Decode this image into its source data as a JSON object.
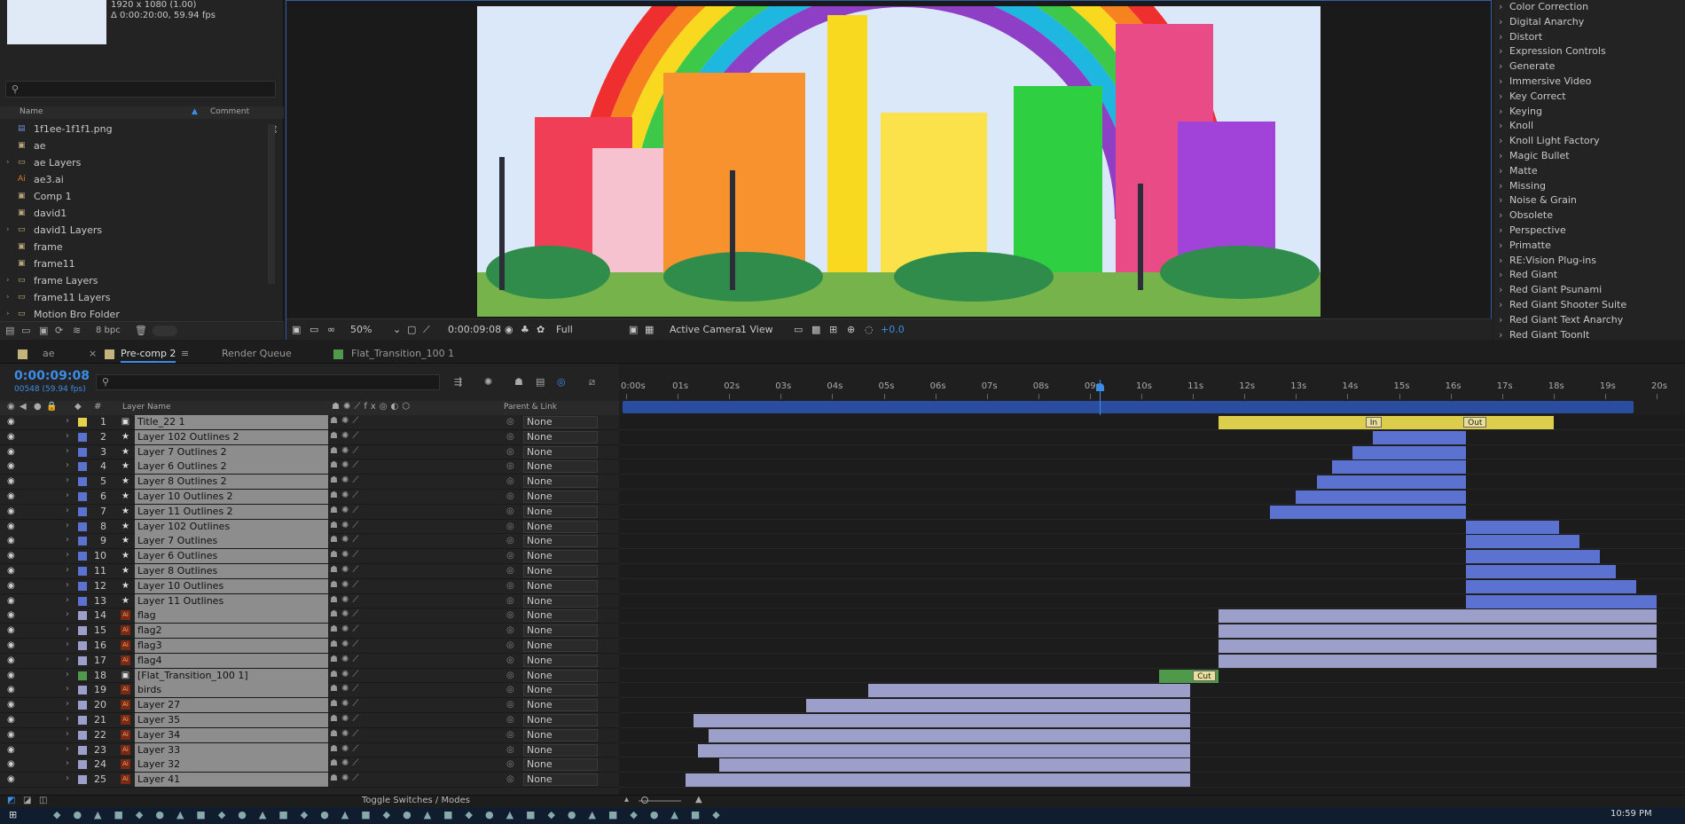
{
  "project": {
    "footage_info_line1": "1920 x 1080 (1.00)",
    "footage_info_line2": "Δ 0:00:20:00, 59.94 fps",
    "search_placeholder": "",
    "col_name": "Name",
    "col_comment": "Comment",
    "items": [
      {
        "name": "1f1ee-1f1f1.png",
        "icon": "image-file-icon",
        "folder": false
      },
      {
        "name": "ae",
        "icon": "composition-icon",
        "folder": false
      },
      {
        "name": "ae Layers",
        "icon": "folder-icon",
        "folder": true
      },
      {
        "name": "ae3.ai",
        "icon": "illustrator-file-icon",
        "folder": false
      },
      {
        "name": "Comp 1",
        "icon": "composition-icon",
        "folder": false
      },
      {
        "name": "david1",
        "icon": "composition-icon",
        "folder": false
      },
      {
        "name": "david1 Layers",
        "icon": "folder-icon",
        "folder": true
      },
      {
        "name": "frame",
        "icon": "composition-icon",
        "folder": false
      },
      {
        "name": "frame11",
        "icon": "composition-icon",
        "folder": false
      },
      {
        "name": "frame Layers",
        "icon": "folder-icon",
        "folder": true
      },
      {
        "name": "frame11 Layers",
        "icon": "folder-icon",
        "folder": true
      },
      {
        "name": "Motion Bro Folder",
        "icon": "folder-icon",
        "folder": true
      }
    ],
    "bpc": "8 bpc"
  },
  "viewer": {
    "zoom": "50%",
    "timecode": "0:00:09:08",
    "resolution": "Full",
    "camera": "Active Camera",
    "views": "1 View",
    "exposure": "+0.0"
  },
  "effects": [
    "Color Correction",
    "Digital Anarchy",
    "Distort",
    "Expression Controls",
    "Generate",
    "Immersive Video",
    "Key Correct",
    "Keying",
    "Knoll",
    "Knoll Light Factory",
    "Magic Bullet",
    "Matte",
    "Missing",
    "Noise & Grain",
    "Obsolete",
    "Perspective",
    "Primatte",
    "RE:Vision Plug-ins",
    "Red Giant",
    "Red Giant Psunami",
    "Red Giant Shooter Suite",
    "Red Giant Text Anarchy",
    "Red Giant ToonIt"
  ],
  "tabs": {
    "t1": "ae",
    "t2": "Pre-comp 2",
    "t3": "Render Queue",
    "t4": "Flat_Transition_100 1"
  },
  "timeline": {
    "current_time": "0:00:09:08",
    "frame_info": "00548 (59.94 fps)",
    "col_layer_name": "Layer Name",
    "col_parent": "Parent & Link",
    "ruler": [
      "0:00s",
      "01s",
      "02s",
      "03s",
      "04s",
      "05s",
      "06s",
      "07s",
      "08s",
      "09s",
      "10s",
      "11s",
      "12s",
      "13s",
      "14s",
      "15s",
      "16s",
      "17s",
      "18s",
      "19s",
      "20s"
    ],
    "marker_in": "In",
    "marker_out": "Out",
    "marker_cut": "Cut",
    "toggle_label": "Toggle Switches / Modes",
    "layers": [
      {
        "n": "1",
        "name": "Title_22 1",
        "type": "precomp",
        "color": "#e6d24a",
        "in": 11.5,
        "out": 18.0,
        "bar": "yel"
      },
      {
        "n": "2",
        "name": "Layer 102 Outlines 2",
        "type": "shape",
        "color": "#5b72d1",
        "in": 14.5,
        "out": 16.3,
        "bar": "blue"
      },
      {
        "n": "3",
        "name": "Layer 7 Outlines 2",
        "type": "shape",
        "color": "#5b72d1",
        "in": 14.1,
        "out": 16.3,
        "bar": "blue"
      },
      {
        "n": "4",
        "name": "Layer 6 Outlines 2",
        "type": "shape",
        "color": "#5b72d1",
        "in": 13.7,
        "out": 16.3,
        "bar": "blue"
      },
      {
        "n": "5",
        "name": "Layer 8 Outlines 2",
        "type": "shape",
        "color": "#5b72d1",
        "in": 13.4,
        "out": 16.3,
        "bar": "blue"
      },
      {
        "n": "6",
        "name": "Layer 10 Outlines 2",
        "type": "shape",
        "color": "#5b72d1",
        "in": 13.0,
        "out": 16.3,
        "bar": "blue"
      },
      {
        "n": "7",
        "name": "Layer 11 Outlines 2",
        "type": "shape",
        "color": "#5b72d1",
        "in": 12.5,
        "out": 16.3,
        "bar": "blue"
      },
      {
        "n": "8",
        "name": "Layer 102 Outlines",
        "type": "shape",
        "color": "#5b72d1",
        "in": 16.3,
        "out": 18.1,
        "bar": "blue"
      },
      {
        "n": "9",
        "name": "Layer 7 Outlines",
        "type": "shape",
        "color": "#5b72d1",
        "in": 16.3,
        "out": 18.5,
        "bar": "blue"
      },
      {
        "n": "10",
        "name": "Layer 6 Outlines",
        "type": "shape",
        "color": "#5b72d1",
        "in": 16.3,
        "out": 18.9,
        "bar": "blue"
      },
      {
        "n": "11",
        "name": "Layer 8 Outlines",
        "type": "shape",
        "color": "#5b72d1",
        "in": 16.3,
        "out": 19.2,
        "bar": "blue"
      },
      {
        "n": "12",
        "name": "Layer 10 Outlines",
        "type": "shape",
        "color": "#5b72d1",
        "in": 16.3,
        "out": 19.6,
        "bar": "blue"
      },
      {
        "n": "13",
        "name": "Layer 11 Outlines",
        "type": "shape",
        "color": "#5b72d1",
        "in": 16.3,
        "out": 20.0,
        "bar": "blue"
      },
      {
        "n": "14",
        "name": "flag",
        "type": "ai",
        "color": "#9d9fcb",
        "in": 11.5,
        "out": 20.0,
        "bar": "lav"
      },
      {
        "n": "15",
        "name": "flag2",
        "type": "ai",
        "color": "#9d9fcb",
        "in": 11.5,
        "out": 20.0,
        "bar": "lav"
      },
      {
        "n": "16",
        "name": "flag3",
        "type": "ai",
        "color": "#9d9fcb",
        "in": 11.5,
        "out": 20.0,
        "bar": "lav"
      },
      {
        "n": "17",
        "name": "flag4",
        "type": "ai",
        "color": "#9d9fcb",
        "in": 11.5,
        "out": 20.0,
        "bar": "lav"
      },
      {
        "n": "18",
        "name": "[Flat_Transition_100 1]",
        "type": "precomp",
        "color": "#4e9a4a",
        "in": 10.35,
        "out": 11.5,
        "bar": "grn"
      },
      {
        "n": "19",
        "name": "birds",
        "type": "ai",
        "color": "#9d9fcb",
        "in": 4.7,
        "out": 10.95,
        "bar": "lav"
      },
      {
        "n": "20",
        "name": "Layer 27",
        "type": "ai",
        "color": "#9d9fcb",
        "in": 3.5,
        "out": 10.95,
        "bar": "lav"
      },
      {
        "n": "21",
        "name": "Layer 35",
        "type": "ai",
        "color": "#9d9fcb",
        "in": 1.3,
        "out": 10.95,
        "bar": "lav"
      },
      {
        "n": "22",
        "name": "Layer 34",
        "type": "ai",
        "color": "#9d9fcb",
        "in": 1.6,
        "out": 10.95,
        "bar": "lav"
      },
      {
        "n": "23",
        "name": "Layer 33",
        "type": "ai",
        "color": "#9d9fcb",
        "in": 1.4,
        "out": 10.95,
        "bar": "lav"
      },
      {
        "n": "24",
        "name": "Layer 32",
        "type": "ai",
        "color": "#9d9fcb",
        "in": 1.8,
        "out": 10.95,
        "bar": "lav"
      },
      {
        "n": "25",
        "name": "Layer 41",
        "type": "ai",
        "color": "#9d9fcb",
        "in": 1.15,
        "out": 10.95,
        "bar": "lav"
      }
    ],
    "parent_value": "None"
  },
  "taskbar": {
    "clock": "10:59 PM"
  }
}
